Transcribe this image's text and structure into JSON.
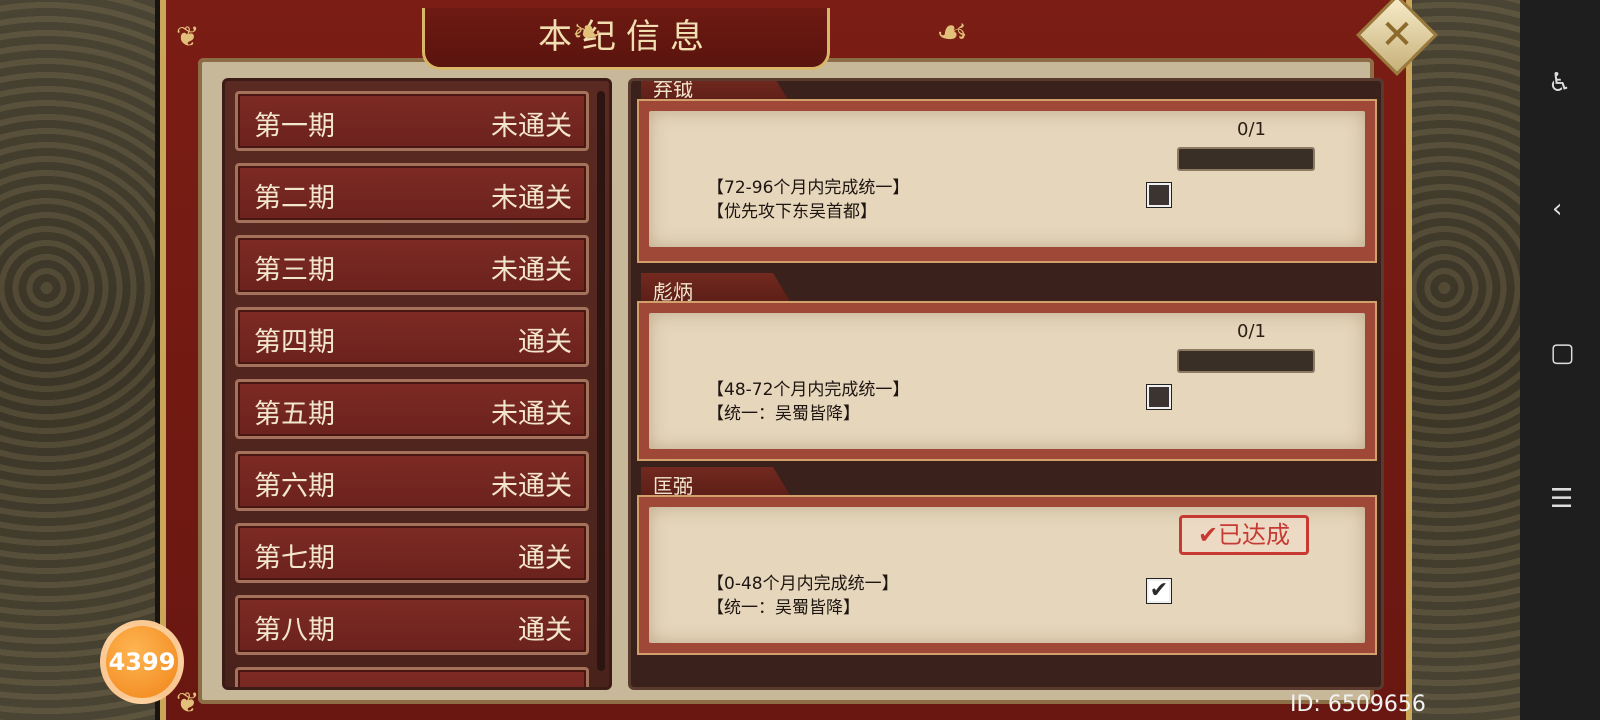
{
  "title": "本纪信息",
  "close_icon": "close-x-icon",
  "periods": [
    {
      "name": "第一期",
      "status": "未通关"
    },
    {
      "name": "第二期",
      "status": "未通关"
    },
    {
      "name": "第三期",
      "status": "未通关"
    },
    {
      "name": "第四期",
      "status": "通关"
    },
    {
      "name": "第五期",
      "status": "未通关"
    },
    {
      "name": "第六期",
      "status": "未通关"
    },
    {
      "name": "第七期",
      "status": "通关"
    },
    {
      "name": "第八期",
      "status": "通关"
    }
  ],
  "achievements": [
    {
      "tab": "弃钺",
      "progress": "0/1",
      "progress_fraction": 0,
      "line1": "【72-96个月内完成统一】",
      "line2": "【优先攻下东吴首都】",
      "checked": false
    },
    {
      "tab": "彪炳",
      "progress": "0/1",
      "progress_fraction": 0,
      "line1": "【48-72个月内完成统一】",
      "line2": "【统一：吴蜀皆降】",
      "checked": false
    },
    {
      "tab": "匡弼",
      "stamp": "✔已达成",
      "line1": "【0-48个月内完成统一】",
      "line2": "【统一：吴蜀皆降】",
      "checked": true
    }
  ],
  "badge": "4399",
  "user_id": "ID: 6509656",
  "colors": {
    "frame_red": "#7b1d14",
    "gold": "#c9a65a",
    "paper": "#e5d6bc",
    "stamp_red": "#c73a33"
  }
}
